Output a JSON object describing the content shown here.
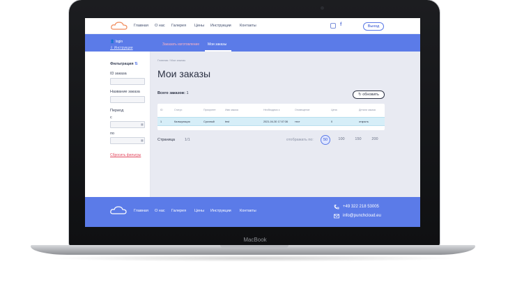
{
  "nav": {
    "links": [
      "Главная",
      "О нас",
      "Галерея",
      "Цены",
      "Инструкции",
      "Контакты"
    ],
    "logout": "Выход"
  },
  "subheader": {
    "user": "login",
    "instructions": "Инструкции",
    "tab_create": "Заказать изготовление",
    "tab_orders": "Мои заказы"
  },
  "sidebar": {
    "filter_label": "Фильтрация",
    "order_id_label": "ID заказа",
    "order_name_label": "Название заказа",
    "period_label": "Период",
    "from_label": "с",
    "to_label": "по",
    "reset_label": "Сбросить фильтры"
  },
  "main": {
    "breadcrumb": "Главная / Мои заказы",
    "title": "Мои заказы",
    "total_label": "Всего заказов:",
    "total_value": "1",
    "refresh_label": "обновить",
    "table": {
      "headers": [
        "ID",
        "Статус",
        "Приоритет",
        "Имя заказа",
        "Необходимо к",
        "Оповещение",
        "Цена",
        "Детали заказа"
      ],
      "rows": [
        [
          "1",
          "Калькуляция",
          "Срочный",
          "test",
          "2021-04-30 17:07:36",
          "тест",
          "0",
          "открыть"
        ]
      ]
    },
    "pagination": {
      "page_label": "Страница",
      "page_value": "1/1",
      "show_label": "отображать по:",
      "options": [
        "50",
        "100",
        "150",
        "200"
      ],
      "selected": "50"
    }
  },
  "footer": {
    "links": [
      "Главная",
      "О нас",
      "Галерея",
      "Цены",
      "Инструкции",
      "Контакты"
    ],
    "phone": "+49 322 218 53005",
    "email": "info@punchcloud.eu"
  },
  "device": {
    "brand": "MacBook"
  },
  "colors": {
    "accent": "#5b7be8",
    "row_highlight": "#d6eef8",
    "danger": "#e2475e"
  }
}
